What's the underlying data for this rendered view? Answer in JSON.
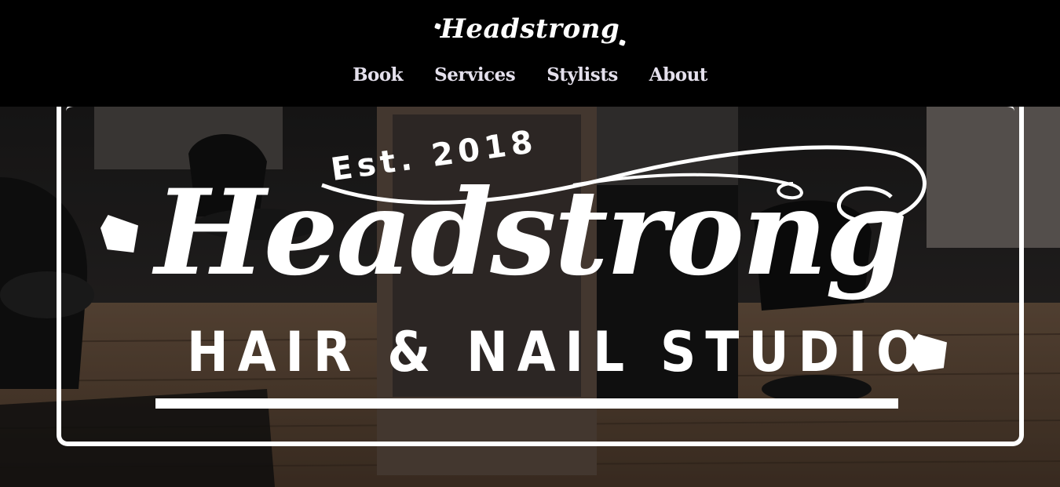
{
  "header": {
    "brand": "Headstrong",
    "nav": [
      {
        "label": "Book"
      },
      {
        "label": "Services"
      },
      {
        "label": "Stylists"
      },
      {
        "label": "About"
      }
    ]
  },
  "hero": {
    "est_text": "Est. 2018",
    "name": "Headstrong",
    "subtitle": "HAIR & NAIL STUDIO"
  },
  "colors": {
    "header_bg": "#000000",
    "logo": "#ffffff",
    "nav_text": "#e4e0ec"
  }
}
